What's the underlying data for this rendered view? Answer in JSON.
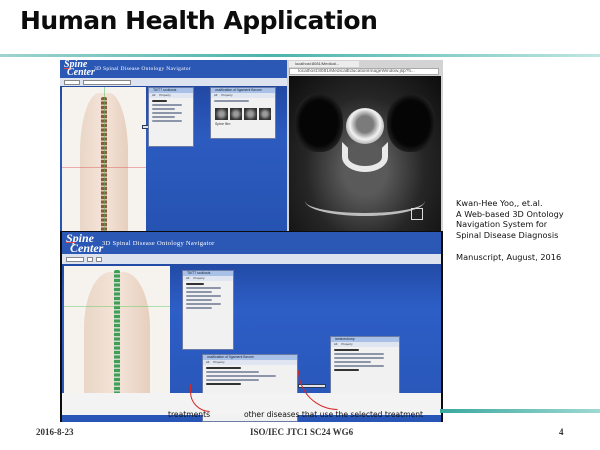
{
  "slide": {
    "title": "Human Health Application",
    "footer_date": "2016-8-23",
    "footer_org": "ISO/IEC JTC1 SC24 WG6",
    "page_number": "4"
  },
  "citation": {
    "author": "Kwan-Hee Yoo,, et.al.",
    "line1": "A Web-based 3D Ontology",
    "line2": "Navigation System for",
    "line3": "Spinal Disease Diagnosis",
    "venue": "Manuscript, August, 2016"
  },
  "top_app": {
    "logo_line1": "Spine",
    "logo_line2": "Center",
    "title": "3D Spinal Disease Ontology Navigator",
    "window_left_title": "T6/T7 scoliosis",
    "window_right_title": "ossification of ligament flavum",
    "window_right_footer": "Spine film"
  },
  "ct_window": {
    "tab_label": "localhost:8081/Medical...",
    "url": "localhost:8081/MedicalEducationImageWindow.jsp?fi..."
  },
  "bottom_app": {
    "logo_line1": "Spine",
    "logo_line2": "Center",
    "title": "3D Spinal Disease Ontology Navigator",
    "window_a_title": "T6/T7 scoliosis",
    "window_b_title": "ossification of ligament flavum",
    "window_c_title": "laminectomy",
    "tab_all": "All",
    "tab_property": "Property"
  },
  "captions": {
    "treatments": "treatments",
    "other_diseases": "other diseases that use the selected treatment"
  }
}
